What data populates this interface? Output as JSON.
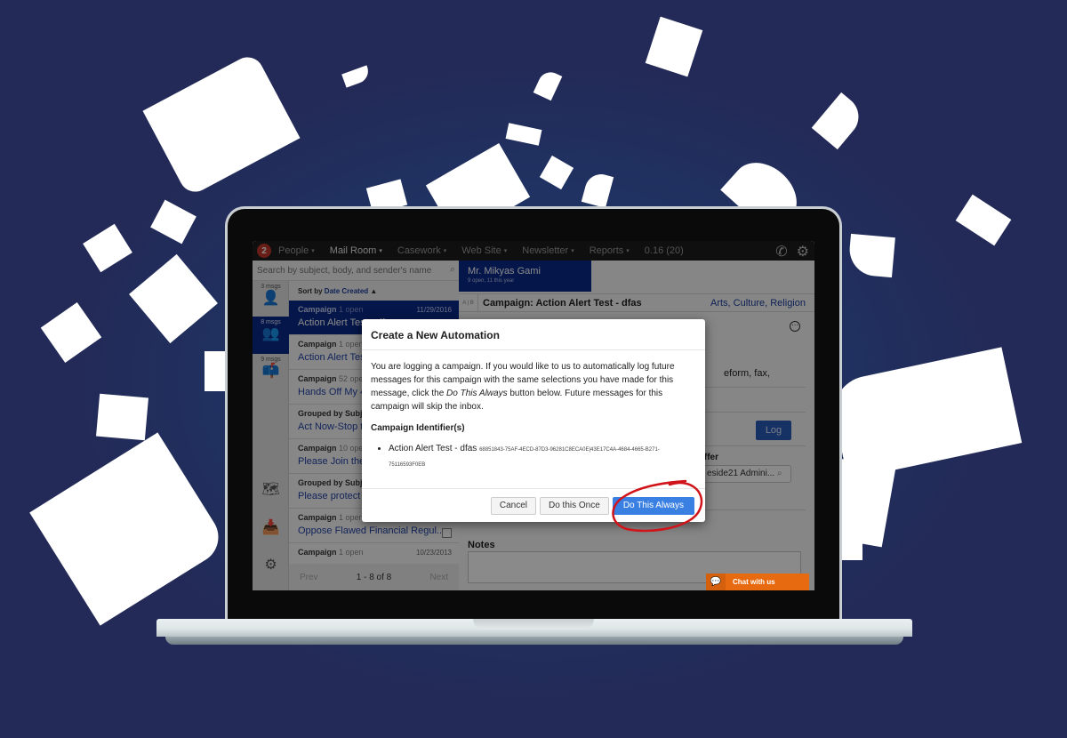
{
  "colors": {
    "background": "#232a57",
    "nav_bg": "#1d1d1d",
    "brand_blue": "#0a2a8a",
    "link_blue": "#1c3e9e",
    "primary_button": "#3a7fe2",
    "log_button": "#2a5cb8",
    "chat_orange": "#e86a10",
    "annotation_red": "#d0141a"
  },
  "topnav": {
    "logo_icon": "app-logo-icon",
    "items": [
      {
        "label": "People",
        "active": false
      },
      {
        "label": "Mail Room",
        "active": true
      },
      {
        "label": "Casework",
        "active": false
      },
      {
        "label": "Web Site",
        "active": false
      },
      {
        "label": "Newsletter",
        "active": false
      },
      {
        "label": "Reports",
        "active": false
      }
    ],
    "version": "0.16 (20)",
    "caret": "▾",
    "phone_icon": "✆",
    "gear_icon": "⚙"
  },
  "search": {
    "placeholder": "Search by subject, body, and sender's name",
    "icon": "⌕"
  },
  "leftrail": {
    "items": [
      {
        "count": "3 msgs",
        "icon": "person-icon",
        "glyph": "👤"
      },
      {
        "count": "8 msgs",
        "icon": "group-icon",
        "glyph": "👥"
      },
      {
        "count": "9 msgs",
        "icon": "mailbox-icon",
        "glyph": "📫"
      }
    ],
    "bottom": [
      {
        "icon": "map-icon",
        "glyph": "🗺"
      },
      {
        "icon": "inbox-icon",
        "glyph": "📥"
      },
      {
        "icon": "settings-icon",
        "glyph": "⚙"
      }
    ]
  },
  "messages": {
    "sort_prefix": "Sort by",
    "sort_field": "Date Created",
    "sort_arrow": "▲",
    "items": [
      {
        "type": "Campaign",
        "meta": "1 open",
        "date": "11/29/2016",
        "subject": "Action Alert Test - dfas",
        "active": true
      },
      {
        "type": "Campaign",
        "meta": "1 open",
        "date": "",
        "subject": "Action Alert Test - dfas",
        "active": false
      },
      {
        "type": "Campaign",
        "meta": "52 open",
        "date": "",
        "subject": "Hands Off My 401k",
        "active": false
      },
      {
        "type": "Grouped by Subject",
        "meta": "",
        "date": "",
        "subject": "Act Now-Stop the Bill",
        "active": false
      },
      {
        "type": "Campaign",
        "meta": "10 open",
        "date": "",
        "subject": "Please Join the Caucus",
        "active": false
      },
      {
        "type": "Grouped by Subject",
        "meta": "",
        "date": "",
        "subject": "Please protect the program",
        "active": false
      },
      {
        "type": "Campaign",
        "meta": "1 open",
        "date": "",
        "subject": "Oppose Flawed Financial Regul...",
        "active": false
      },
      {
        "type": "Campaign",
        "meta": "1 open",
        "date": "10/23/2013",
        "subject": "",
        "active": false
      }
    ],
    "pager": {
      "prev": "Prev",
      "range": "1 - 8 of 8",
      "next": "Next"
    }
  },
  "main": {
    "person_name": "Mr. Mikyas Gami",
    "person_sub": "9 open, 11 this year",
    "ab_label": "A | B",
    "campaign_title": "Campaign: Action Alert Test - dfas",
    "issues": "Arts, Culture, Religion",
    "more_icon": "⋯",
    "body_fragment": "eform, fax,",
    "log_button": "Log",
    "officer_label": "ffer",
    "officer_value": "eside21 Admini...",
    "officer_icon": "⌕",
    "notes_label": "Notes",
    "chat_label": "Chat with us",
    "chat_icon": "💬"
  },
  "modal": {
    "title": "Create a New Automation",
    "body_part1": "You are logging a campaign. If you would like to us to automatically log future messages for this campaign with the same selections you have made for this message, click the ",
    "body_emphasis": "Do This Always",
    "body_part2": " button below. Future messages for this campaign will skip the inbox.",
    "identifiers_title": "Campaign Identifier(s)",
    "identifiers": [
      {
        "name": "Action Alert Test - dfas",
        "id": "68851843-75AF-4ECD-87D3-96281C8ECA0E|43E17C4A-4684-4665-B271-75116593F0EB"
      }
    ],
    "buttons": {
      "cancel": "Cancel",
      "once": "Do this Once",
      "always": "Do This Always"
    }
  }
}
